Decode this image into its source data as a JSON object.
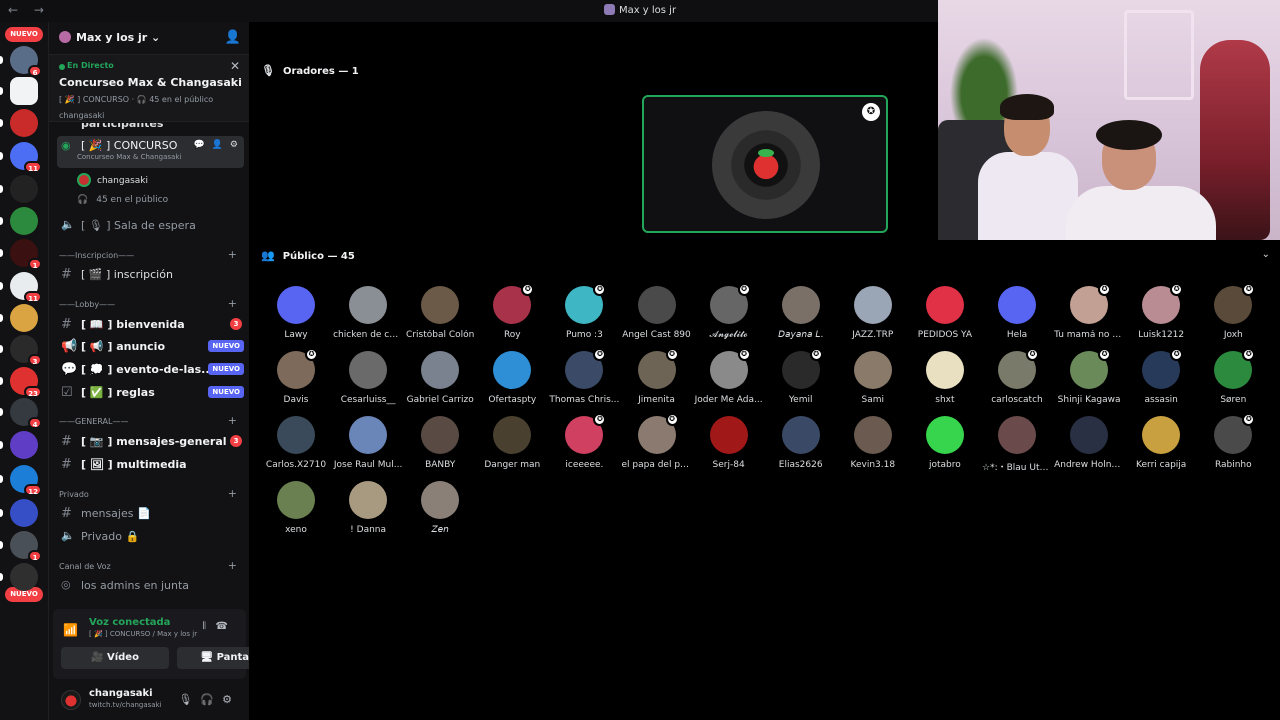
{
  "window": {
    "title": "Max y los jr",
    "nav": "← →"
  },
  "rail": {
    "nuevo_top": "NUEVO",
    "nuevo_bottom": "NUEVO",
    "servers": [
      {
        "badge": "6",
        "color": "#5a6d88"
      },
      {
        "badge": "",
        "color": "#f2f3f5"
      },
      {
        "badge": "",
        "color": "#c92a2a"
      },
      {
        "badge": "11",
        "color": "#4c6ef5"
      },
      {
        "badge": "",
        "color": "#222"
      },
      {
        "badge": "",
        "color": "#2b8a3e"
      },
      {
        "badge": "1",
        "color": "#3b1010"
      },
      {
        "badge": "11",
        "color": "#e9ecef"
      },
      {
        "badge": "",
        "color": "#d9a441"
      },
      {
        "badge": "3",
        "color": "#2a2a2a"
      },
      {
        "badge": "23",
        "color": "#e03131"
      },
      {
        "badge": "4",
        "color": "#343a40"
      },
      {
        "badge": "",
        "color": "#5f3dc4"
      },
      {
        "badge": "12",
        "color": "#1c7ed6"
      },
      {
        "badge": "",
        "color": "#364fc7"
      },
      {
        "badge": "1",
        "color": "#495057"
      },
      {
        "badge": "",
        "color": "#2f2f2f"
      }
    ]
  },
  "sidebar": {
    "server_name": "Max y los jr ⌄",
    "live": {
      "label": "En Directo",
      "title": "Concurseo Max & Changasaki",
      "sub": "[ 🎉 ] CONCURSO · 🎧 45 en el público",
      "host": "changasaki"
    },
    "cut_channel": "participantes",
    "voice_channel": {
      "name": "[ 🎉 ] CONCURSO",
      "desc": "Concurseo Max & Changasaki",
      "tools": "💬 👤 ⚙"
    },
    "voice_user": "changasaki",
    "audience_count": "45 en el público",
    "waiting": "[ 🎙 ] Sala de espera",
    "categories": {
      "inscripcion": "——Inscripcion——",
      "lobby": "——Lobby——",
      "general": "——GENERAL——",
      "privado": "Privado",
      "canal_voz": "Canal de Voz"
    },
    "channels": {
      "inscripcion": "[ 🎬 ] inscripción",
      "bienvenida": "[ 📖 ] bienvenida",
      "anuncio": "[ 📢 ] anuncio",
      "evento": "[ 💭 ] evento-de-las...",
      "reglas": "[ ✅ ] reglas",
      "mensajes_general": "[ 📷 ] mensajes-general",
      "multimedia": "[ 🖼 ] multimedia",
      "mensajes": "mensajes 📄",
      "privado": "Privado 🔒",
      "admins": "los admins en junta"
    },
    "counts": {
      "bienvenida": "3",
      "mensajes_general": "3"
    },
    "new_label": "NUEVO",
    "voice_panel": {
      "title": "Voz conectada",
      "sub": "[ 🎉 ] CONCURSO / Max y los jr",
      "video": "Vídeo",
      "screen": "Pantalla"
    },
    "user": {
      "name": "changasaki",
      "status": "twitch.tv/changasaki"
    }
  },
  "main": {
    "speakers_header": "Oradores — 1",
    "audience_header": "Público — 45",
    "audience": [
      {
        "name": "Lawy",
        "color": "#5865f2",
        "star": false
      },
      {
        "name": "chicken de co...",
        "color": "#8a8f95",
        "star": false
      },
      {
        "name": "Cristóbal Colón",
        "color": "#6b5a48",
        "star": false
      },
      {
        "name": "Roy",
        "color": "#a8324a",
        "star": true
      },
      {
        "name": "Pumo :3",
        "color": "#3fb6c4",
        "star": true
      },
      {
        "name": "Angel Cast 890",
        "color": "#4a4a4a",
        "star": false
      },
      {
        "name": "𝓐𝓷𝓰𝓮𝓵𝓲𝓽𝓸",
        "color": "#666",
        "star": true
      },
      {
        "name": "𝘋𝘢𝘺𝘢𝘯𝘢 𝘓.",
        "color": "#7a7068",
        "star": false
      },
      {
        "name": "JAZZ.TRP",
        "color": "#9aa5b5",
        "star": false
      },
      {
        "name": "PEDIDOS YA",
        "color": "#e03147",
        "star": false
      },
      {
        "name": "Hela",
        "color": "#5865f2",
        "star": false
      },
      {
        "name": "Tu mamá no t...",
        "color": "#c2a094",
        "star": true
      },
      {
        "name": "Luisk1212",
        "color": "#b98c93",
        "star": true
      },
      {
        "name": "Joxh",
        "color": "#5a4a3a",
        "star": true
      },
      {
        "name": "Davis",
        "color": "#7d6a5a",
        "star": true
      },
      {
        "name": "Cesarluiss__",
        "color": "#6a6a6a",
        "star": false
      },
      {
        "name": "Gabriel Carrizo",
        "color": "#7a8290",
        "star": false
      },
      {
        "name": "Ofertaspty",
        "color": "#2e8fd6",
        "star": false
      },
      {
        "name": "Thomas Chris...",
        "color": "#3b4a66",
        "star": true
      },
      {
        "name": "Jimenita",
        "color": "#6d6455",
        "star": true
      },
      {
        "name": "Joder Me Ada...",
        "color": "#8a8a8a",
        "star": true
      },
      {
        "name": "Yemil",
        "color": "#2a2a2a",
        "star": true
      },
      {
        "name": "Sami",
        "color": "#8a7a6a",
        "star": false
      },
      {
        "name": "shxt",
        "color": "#e8e0c0",
        "star": false
      },
      {
        "name": "carloscatch",
        "color": "#7a7a6a",
        "star": true
      },
      {
        "name": "Shinji Kagawa",
        "color": "#6a8a5a",
        "star": true
      },
      {
        "name": "assasin",
        "color": "#283a5a",
        "star": true
      },
      {
        "name": "Søren",
        "color": "#2b8a3e",
        "star": true
      },
      {
        "name": "Carlos.X2710",
        "color": "#3a4a5a",
        "star": false
      },
      {
        "name": "Jose Raul Mul...",
        "color": "#6a86b8",
        "star": false
      },
      {
        "name": "BANBY",
        "color": "#5a4a44",
        "star": false
      },
      {
        "name": "Danger man",
        "color": "#4a4030",
        "star": false
      },
      {
        "name": "iceeeee.",
        "color": "#d04060",
        "star": true
      },
      {
        "name": "el papa del pa...",
        "color": "#8a7a70",
        "star": true
      },
      {
        "name": "Serj-84",
        "color": "#a01818",
        "star": false
      },
      {
        "name": "Elias2626",
        "color": "#3a4a66",
        "star": false
      },
      {
        "name": "Kevin3.18",
        "color": "#6a5a50",
        "star": false
      },
      {
        "name": "jotabro",
        "color": "#37d44d",
        "star": false
      },
      {
        "name": "☆*:・Blau Uta・...",
        "color": "#6a4a4a",
        "star": false
      },
      {
        "name": "Andrew Holne...",
        "color": "#2a3044",
        "star": false
      },
      {
        "name": "Kerri capija",
        "color": "#c8a040",
        "star": false
      },
      {
        "name": "Rabinho",
        "color": "#4a4a4a",
        "star": true
      },
      {
        "name": "xeno",
        "color": "#6a8050",
        "star": false
      },
      {
        "name": "! Danna",
        "color": "#a89a80",
        "star": false
      },
      {
        "name": "𝘡𝘦𝘯",
        "color": "#8a8078",
        "star": false
      }
    ]
  }
}
